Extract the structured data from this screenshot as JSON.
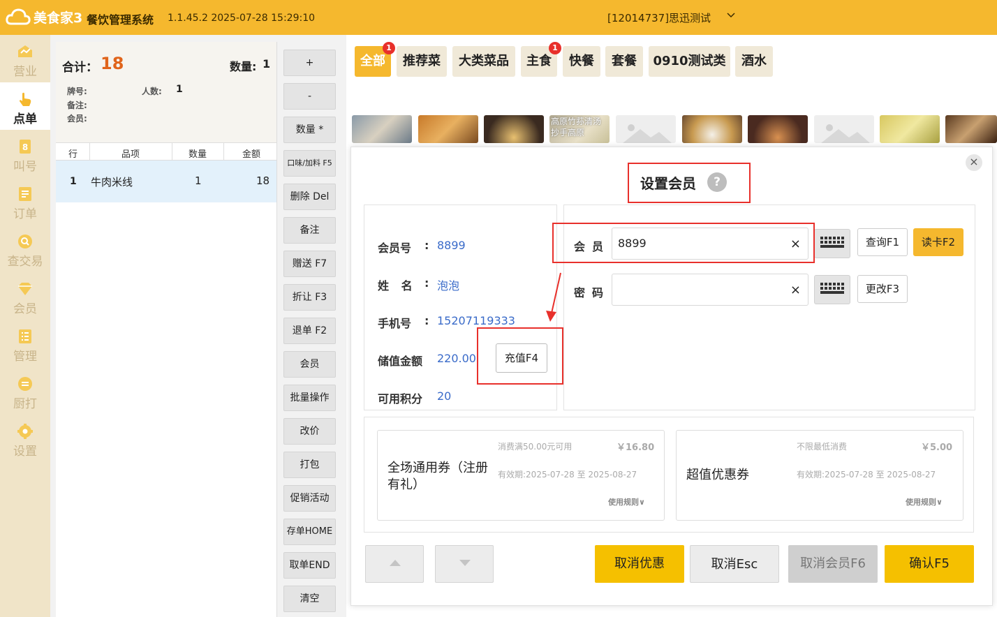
{
  "header": {
    "logo_text": "美食家3",
    "app_title": "餐饮管理系统",
    "version": "1.1.45.2 2025-07-28 15:29:10",
    "store": "[12014737]思迅测试"
  },
  "nav": {
    "items": [
      {
        "label": "营业",
        "icon": "business-icon"
      },
      {
        "label": "点单",
        "icon": "order-hand-icon"
      },
      {
        "label": "叫号",
        "icon": "call-number-icon"
      },
      {
        "label": "订单",
        "icon": "orders-icon"
      },
      {
        "label": "查交易",
        "icon": "search-trade-icon"
      },
      {
        "label": "会员",
        "icon": "member-diamond-icon"
      },
      {
        "label": "管理",
        "icon": "manage-icon"
      },
      {
        "label": "厨打",
        "icon": "kitchen-print-icon"
      },
      {
        "label": "设置",
        "icon": "gear-icon"
      }
    ]
  },
  "order": {
    "total_label": "合计：",
    "total_value": "18",
    "qty_label": "数量:",
    "qty_value": "1",
    "plate_label": "牌号:",
    "people_label": "人数:",
    "people_value": "1",
    "note_label": "备注:",
    "member_label": "会员:",
    "columns": [
      "行",
      "品项",
      "数量",
      "金额"
    ],
    "rows": [
      {
        "row": "1",
        "item": "牛肉米线",
        "qty": "1",
        "amount": "18"
      }
    ]
  },
  "actions": [
    "+",
    "-",
    "数量 *",
    "口味/加料 F5",
    "删除 Del",
    "备注",
    "赠送 F7",
    "折让 F3",
    "退单 F2",
    "会员",
    "批量操作",
    "改价",
    "打包",
    "促销活动",
    "存单HOME",
    "取单END",
    "清空"
  ],
  "categories": [
    {
      "label": "全部",
      "badge": "1"
    },
    {
      "label": "推荐菜",
      "badge": ""
    },
    {
      "label": "大类菜品",
      "badge": ""
    },
    {
      "label": "主食",
      "badge": "1"
    },
    {
      "label": "快餐",
      "badge": ""
    },
    {
      "label": "套餐",
      "badge": ""
    },
    {
      "label": "0910测试类",
      "badge": ""
    },
    {
      "label": "酒水",
      "badge": ""
    }
  ],
  "dish_thumb_caption": "高原竹荪清汤抄手高原",
  "dialog": {
    "title": "设置会员",
    "help_glyph": "?",
    "close_glyph": "×",
    "info": {
      "member_no_label": "会员号",
      "member_no": "8899",
      "name_label": "姓 名",
      "name": "泡泡",
      "phone_label": "手机号",
      "phone": "15207119333",
      "balance_label": "储值金额",
      "balance": "220.00",
      "points_label": "可用积分",
      "points": "20",
      "colon": ":",
      "recharge_button": "充值F4"
    },
    "input": {
      "member_label": "会员",
      "member_value": "8899",
      "password_label": "密码",
      "password_value": "",
      "clear_glyph": "×",
      "query_button": "查询F1",
      "read_card_button": "读卡F2",
      "change_button": "更改F3"
    },
    "coupons": [
      {
        "name": "全场通用券（注册有礼）",
        "condition": "消费满50.00元可用",
        "amount": "￥16.80",
        "valid": "有效期:2025-07-28 至 2025-08-27",
        "rule": "使用规则∨"
      },
      {
        "name": "超值优惠券",
        "condition": "不限最低消费",
        "amount": "￥5.00",
        "valid": "有效期:2025-07-28 至 2025-08-27",
        "rule": "使用规则∨"
      }
    ],
    "footer": {
      "cancel_discount": "取消优惠",
      "cancel_esc": "取消Esc",
      "cancel_member": "取消会员F6",
      "confirm": "确认F5"
    }
  },
  "colors": {
    "accent": "#f5b82e",
    "confirm": "#f5c000",
    "link_blue": "#3a6bc9",
    "highlight_red": "#e8302b",
    "total_orange": "#e0641b"
  }
}
